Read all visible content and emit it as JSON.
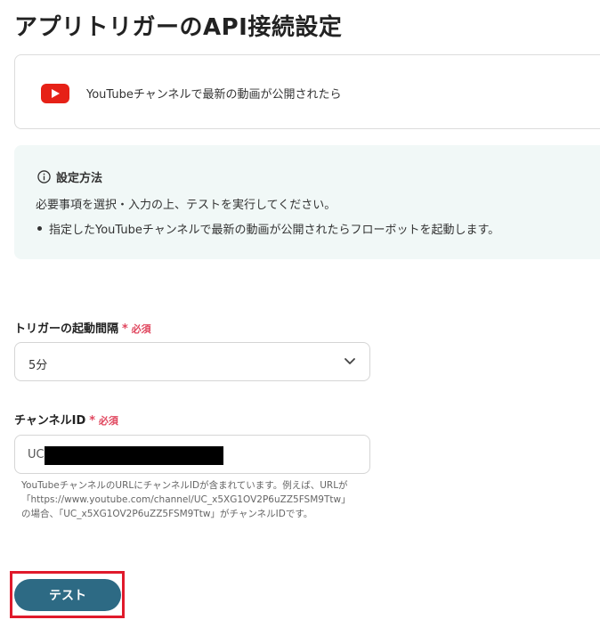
{
  "page": {
    "title": "アプリトリガーのAPI接続設定"
  },
  "trigger": {
    "icon": "youtube-icon",
    "label": "YouTubeチャンネルで最新の動画が公開されたら"
  },
  "info": {
    "icon": "info-circle-icon",
    "title": "設定方法",
    "description": "必要事項を選択・入力の上、テストを実行してください。",
    "bullets": [
      "指定したYouTubeチャンネルで最新の動画が公開されたらフローボットを起動します。"
    ]
  },
  "form": {
    "required_star": "*",
    "required_text": "必須",
    "interval": {
      "label": "トリガーの起動間隔",
      "value": "5分",
      "icon": "chevron-down-icon"
    },
    "channel": {
      "label": "チャンネルID",
      "value_visible": "UC",
      "help_lines": [
        "YouTubeチャンネルのURLにチャンネルIDが含まれています。例えば、URLが",
        "「https://www.youtube.com/channel/UC_x5XG1OV2P6uZZ5FSM9Ttw」",
        "の場合、「UC_x5XG1OV2P6uZZ5FSM9Ttw」がチャンネルIDです。"
      ]
    }
  },
  "actions": {
    "test_label": "テスト"
  },
  "colors": {
    "accent": "#2d6a84",
    "required": "#e0465e",
    "highlight": "#e01a2b",
    "youtube": "#e62117",
    "info_bg": "#f1f8f7"
  }
}
